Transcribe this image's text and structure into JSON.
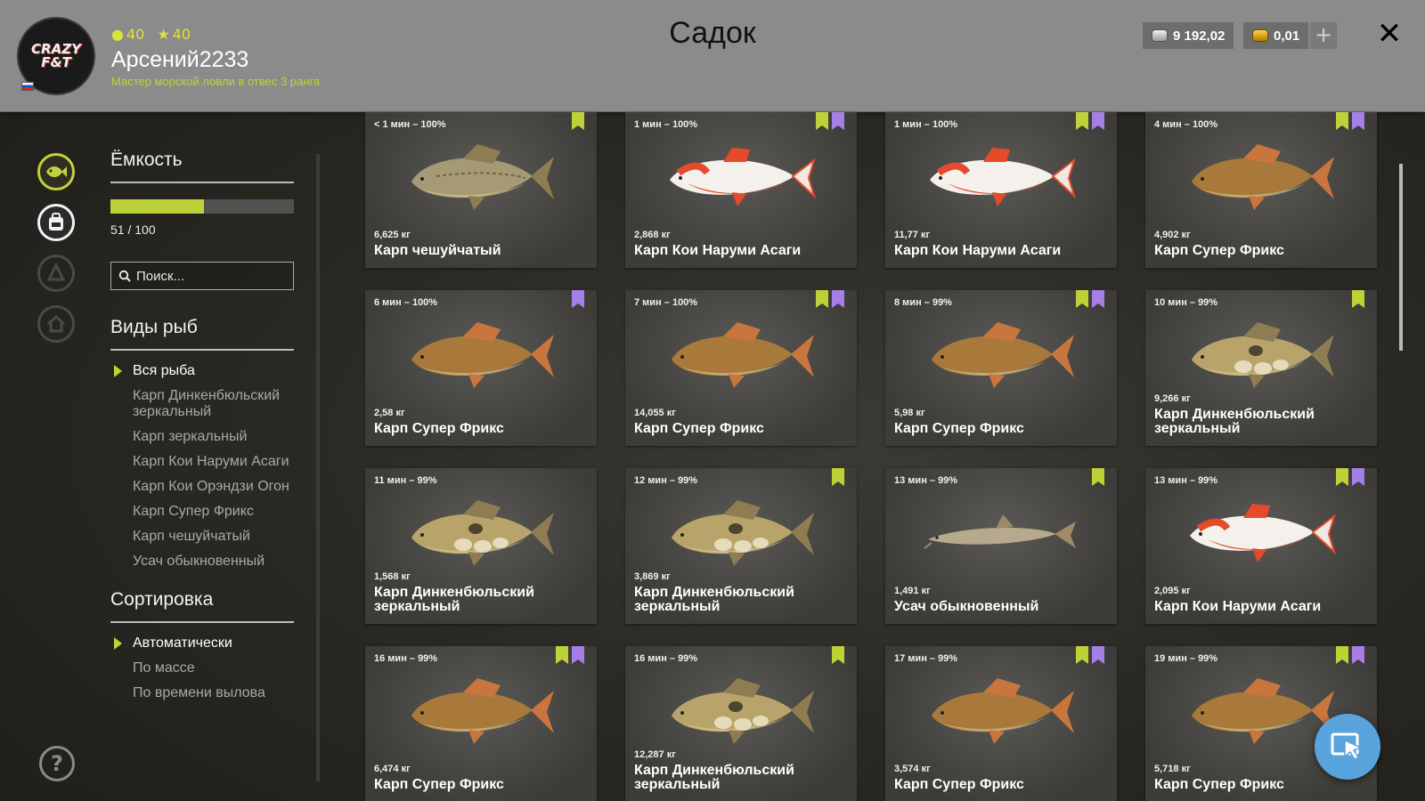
{
  "header": {
    "title": "Садок",
    "avatar_text": "CRAZY F&T",
    "level_1": "40",
    "level_2": "40",
    "username": "Арсений2233",
    "rank": "Мастер морской ловли в отвес 3 ранга",
    "silver_amount": "9 192,02",
    "gold_amount": "0,01",
    "plus_label": "+",
    "close_label": "✕"
  },
  "colors": {
    "accent": "#bcd236",
    "header_bg": "#8b8b8b",
    "purple_badge": "#a57fe6",
    "fab": "#5aa4dd"
  },
  "nav": {
    "icons": [
      "fish-icon",
      "backpack-icon",
      "boat-icon",
      "home-icon"
    ],
    "help": "?"
  },
  "sidebar": {
    "capacity_title": "Ёмкость",
    "capacity_used": 51,
    "capacity_total": 100,
    "capacity_label": "51 / 100",
    "search_placeholder": "Поиск...",
    "species_title": "Виды рыб",
    "species": [
      {
        "label": "Вся рыба",
        "selected": true
      },
      {
        "label": "Карп Динкенбюльский зеркальный",
        "selected": false
      },
      {
        "label": "Карп зеркальный",
        "selected": false
      },
      {
        "label": "Карп Кои Наруми Асаги",
        "selected": false
      },
      {
        "label": "Карп Кои Орэндзи Огон",
        "selected": false
      },
      {
        "label": "Карп Супер Фрикс",
        "selected": false
      },
      {
        "label": "Карп чешуйчатый",
        "selected": false
      },
      {
        "label": "Усач обыкновенный",
        "selected": false
      }
    ],
    "sort_title": "Сортировка",
    "sort": [
      {
        "label": "Автоматически",
        "selected": true
      },
      {
        "label": "По массе",
        "selected": false
      },
      {
        "label": "По времени вылова",
        "selected": false
      }
    ]
  },
  "fish_cards": [
    {
      "time": "< 1 мин – 100%",
      "weight": "6,625 кг",
      "name": "Карп чешуйчатый",
      "badges": [
        "green"
      ],
      "kind": "common"
    },
    {
      "time": "1 мин – 100%",
      "weight": "2,868 кг",
      "name": "Карп Кои Наруми Асаги",
      "badges": [
        "green",
        "purple"
      ],
      "kind": "koi"
    },
    {
      "time": "1 мин – 100%",
      "weight": "11,77 кг",
      "name": "Карп Кои Наруми Асаги",
      "badges": [
        "green",
        "purple"
      ],
      "kind": "koi"
    },
    {
      "time": "4 мин – 100%",
      "weight": "4,902 кг",
      "name": "Карп Супер Фрикс",
      "badges": [
        "green",
        "purple"
      ],
      "kind": "super"
    },
    {
      "time": "6 мин – 100%",
      "weight": "2,58 кг",
      "name": "Карп Супер Фрикс",
      "badges": [
        "purple"
      ],
      "kind": "super"
    },
    {
      "time": "7 мин – 100%",
      "weight": "14,055 кг",
      "name": "Карп Супер Фрикс",
      "badges": [
        "green",
        "purple"
      ],
      "kind": "super"
    },
    {
      "time": "8 мин – 99%",
      "weight": "5,98 кг",
      "name": "Карп Супер Фрикс",
      "badges": [
        "green",
        "purple"
      ],
      "kind": "super"
    },
    {
      "time": "10 мин – 99%",
      "weight": "9,266 кг",
      "name": "Карп Динкенбюльский зеркальный",
      "badges": [
        "green"
      ],
      "kind": "mirror"
    },
    {
      "time": "11 мин – 99%",
      "weight": "1,568 кг",
      "name": "Карп Динкенбюльский зеркальный",
      "badges": [],
      "kind": "mirror"
    },
    {
      "time": "12 мин – 99%",
      "weight": "3,869 кг",
      "name": "Карп Динкенбюльский зеркальный",
      "badges": [
        "green"
      ],
      "kind": "mirror"
    },
    {
      "time": "13 мин – 99%",
      "weight": "1,491 кг",
      "name": "Усач обыкновенный",
      "badges": [
        "green"
      ],
      "kind": "barbel"
    },
    {
      "time": "13 мин – 99%",
      "weight": "2,095 кг",
      "name": "Карп Кои Наруми Асаги",
      "badges": [
        "green",
        "purple"
      ],
      "kind": "koi"
    },
    {
      "time": "16 мин – 99%",
      "weight": "6,474 кг",
      "name": "Карп Супер Фрикс",
      "badges": [
        "green",
        "purple"
      ],
      "kind": "super"
    },
    {
      "time": "16 мин – 99%",
      "weight": "12,287 кг",
      "name": "Карп Динкенбюльский зеркальный",
      "badges": [
        "green"
      ],
      "kind": "mirror"
    },
    {
      "time": "17 мин – 99%",
      "weight": "3,574 кг",
      "name": "Карп Супер Фрикс",
      "badges": [
        "green",
        "purple"
      ],
      "kind": "super"
    },
    {
      "time": "19 мин – 99%",
      "weight": "5,718 кг",
      "name": "Карп Супер Фрикс",
      "badges": [
        "green",
        "purple"
      ],
      "kind": "super"
    }
  ]
}
